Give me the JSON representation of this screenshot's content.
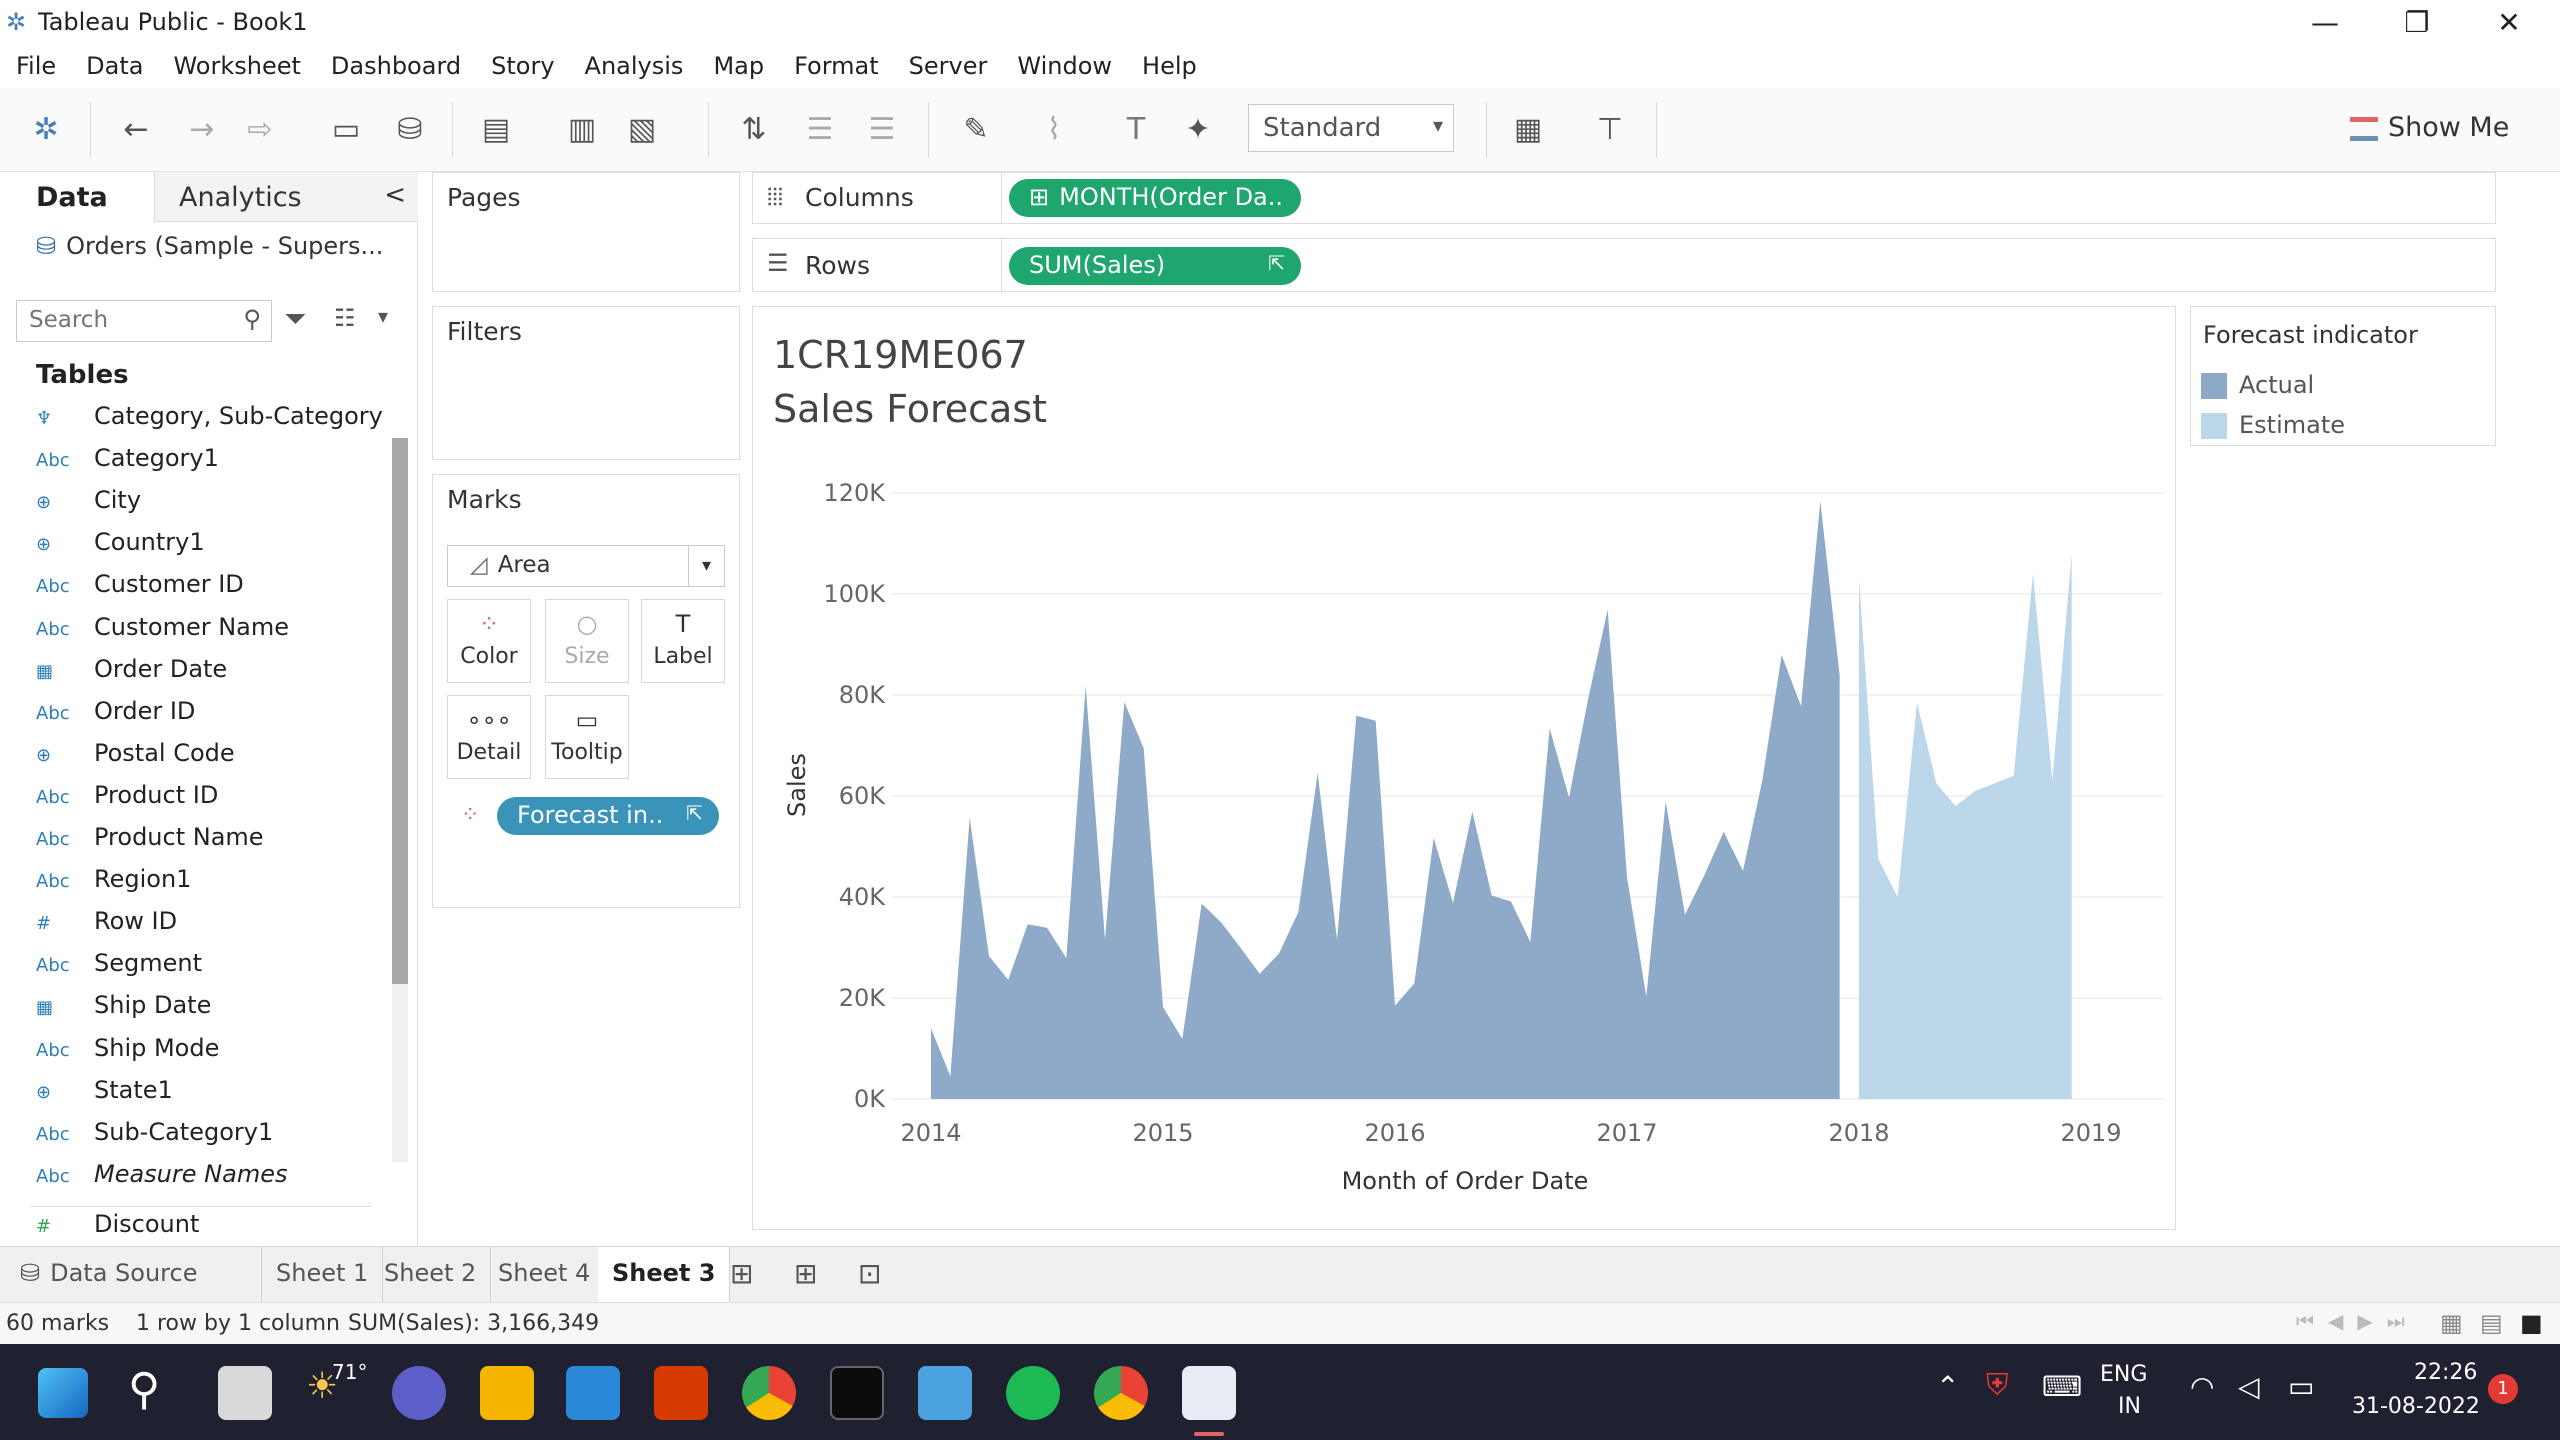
{
  "window": {
    "title": "Tableau Public - Book1",
    "minimize": "—",
    "maximize": "❐",
    "close": "✕"
  },
  "menu": [
    "File",
    "Data",
    "Worksheet",
    "Dashboard",
    "Story",
    "Analysis",
    "Map",
    "Format",
    "Server",
    "Window",
    "Help"
  ],
  "toolbar": {
    "fit_value": "Standard",
    "show_me_label": "Show Me"
  },
  "data_pane": {
    "tabs": {
      "data": "Data",
      "analytics": "Analytics",
      "collapse": "<"
    },
    "datasource": "Orders (Sample - Supers...",
    "search_placeholder": "Search",
    "tables_header": "Tables",
    "fields": [
      {
        "icon": "hierarchy-icon",
        "glyph": "♆",
        "label": "Category, Sub-Category"
      },
      {
        "icon": "abc-icon",
        "glyph": "Abc",
        "label": "Category1"
      },
      {
        "icon": "globe-icon",
        "glyph": "⊕",
        "label": "City"
      },
      {
        "icon": "globe-icon",
        "glyph": "⊕",
        "label": "Country1"
      },
      {
        "icon": "abc-icon",
        "glyph": "Abc",
        "label": "Customer ID"
      },
      {
        "icon": "abc-icon",
        "glyph": "Abc",
        "label": "Customer Name"
      },
      {
        "icon": "calendar-icon",
        "glyph": "▦",
        "label": "Order Date"
      },
      {
        "icon": "abc-icon",
        "glyph": "Abc",
        "label": "Order ID"
      },
      {
        "icon": "globe-icon",
        "glyph": "⊕",
        "label": "Postal Code"
      },
      {
        "icon": "abc-icon",
        "glyph": "Abc",
        "label": "Product ID"
      },
      {
        "icon": "abc-icon",
        "glyph": "Abc",
        "label": "Product Name"
      },
      {
        "icon": "abc-icon",
        "glyph": "Abc",
        "label": "Region1"
      },
      {
        "icon": "hash-icon",
        "glyph": "#",
        "label": "Row ID"
      },
      {
        "icon": "abc-icon",
        "glyph": "Abc",
        "label": "Segment"
      },
      {
        "icon": "calendar-icon",
        "glyph": "▦",
        "label": "Ship Date"
      },
      {
        "icon": "abc-icon",
        "glyph": "Abc",
        "label": "Ship Mode"
      },
      {
        "icon": "globe-icon",
        "glyph": "⊕",
        "label": "State1"
      },
      {
        "icon": "abc-icon",
        "glyph": "Abc",
        "label": "Sub-Category1"
      },
      {
        "icon": "abc-icon",
        "glyph": "Abc",
        "label": "Measure Names"
      },
      {
        "icon": "hash-icon",
        "glyph": "#",
        "label": "Discount"
      }
    ]
  },
  "shelves": {
    "pages": "Pages",
    "filters": "Filters",
    "marks": "Marks",
    "mark_type": "Area",
    "mark_buttons": [
      "Color",
      "Size",
      "Label",
      "Detail",
      "Tooltip"
    ],
    "marks_pill": "Forecast in..",
    "columns_label": "Columns",
    "columns_pill": "MONTH(Order Da..",
    "rows_label": "Rows",
    "rows_pill": "SUM(Sales)"
  },
  "legend": {
    "title": "Forecast indicator",
    "items": [
      {
        "label": "Actual",
        "color": "#8fa9c8"
      },
      {
        "label": "Estimate",
        "color": "#bcd6ea"
      }
    ]
  },
  "chart_data": {
    "type": "area",
    "title": "1CR19ME067",
    "subtitle": "Sales Forecast",
    "xlabel": "Month of Order Date",
    "ylabel": "Sales",
    "ylim": [
      0,
      120000
    ],
    "yticks": [
      "0K",
      "20K",
      "40K",
      "60K",
      "80K",
      "100K",
      "120K"
    ],
    "xticks": [
      "2014",
      "2015",
      "2016",
      "2017",
      "2018",
      "2019"
    ],
    "series": [
      {
        "name": "Actual",
        "color": "#8fa9c8",
        "x": [
          "2014-01",
          "2014-02",
          "2014-03",
          "2014-04",
          "2014-05",
          "2014-06",
          "2014-07",
          "2014-08",
          "2014-09",
          "2014-10",
          "2014-11",
          "2014-12",
          "2015-01",
          "2015-02",
          "2015-03",
          "2015-04",
          "2015-05",
          "2015-06",
          "2015-07",
          "2015-08",
          "2015-09",
          "2015-10",
          "2015-11",
          "2015-12",
          "2016-01",
          "2016-02",
          "2016-03",
          "2016-04",
          "2016-05",
          "2016-06",
          "2016-07",
          "2016-08",
          "2016-09",
          "2016-10",
          "2016-11",
          "2016-12",
          "2017-01",
          "2017-02",
          "2017-03",
          "2017-04",
          "2017-05",
          "2017-06",
          "2017-07",
          "2017-08",
          "2017-09",
          "2017-10",
          "2017-11",
          "2017-12"
        ],
        "values": [
          14000,
          4500,
          55700,
          28300,
          23600,
          34600,
          33900,
          27900,
          81800,
          31500,
          78600,
          69500,
          18200,
          11900,
          38700,
          35000,
          30000,
          24800,
          28800,
          37000,
          64600,
          31500,
          75900,
          74900,
          18500,
          22900,
          51700,
          38800,
          56900,
          40300,
          39100,
          31100,
          73400,
          59700,
          79400,
          96900,
          43900,
          20300,
          58900,
          36500,
          44300,
          52900,
          45200,
          63100,
          87900,
          77800,
          118400,
          83800
        ]
      },
      {
        "name": "Estimate",
        "color": "#bcd6ea",
        "x": [
          "2018-01",
          "2018-02",
          "2018-03",
          "2018-04",
          "2018-05",
          "2018-06",
          "2018-07",
          "2018-08",
          "2018-09",
          "2018-10",
          "2018-11",
          "2018-12"
        ],
        "values": [
          103000,
          47500,
          40000,
          78500,
          62500,
          58000,
          61000,
          62500,
          64000,
          104000,
          63000,
          108000
        ]
      }
    ]
  },
  "sheets": [
    "Sheet 1",
    "Sheet 2",
    "Sheet 4",
    "Sheet 3"
  ],
  "data_source_tab": "Data Source",
  "status": {
    "marks": "60 marks",
    "rows": "1 row by 1 column",
    "sum": "SUM(Sales): 3,166,349"
  },
  "taskbar": {
    "weather": "71°",
    "lang": "ENG",
    "region": "IN",
    "time": "22:26",
    "date": "31-08-2022",
    "notifications": "1"
  }
}
